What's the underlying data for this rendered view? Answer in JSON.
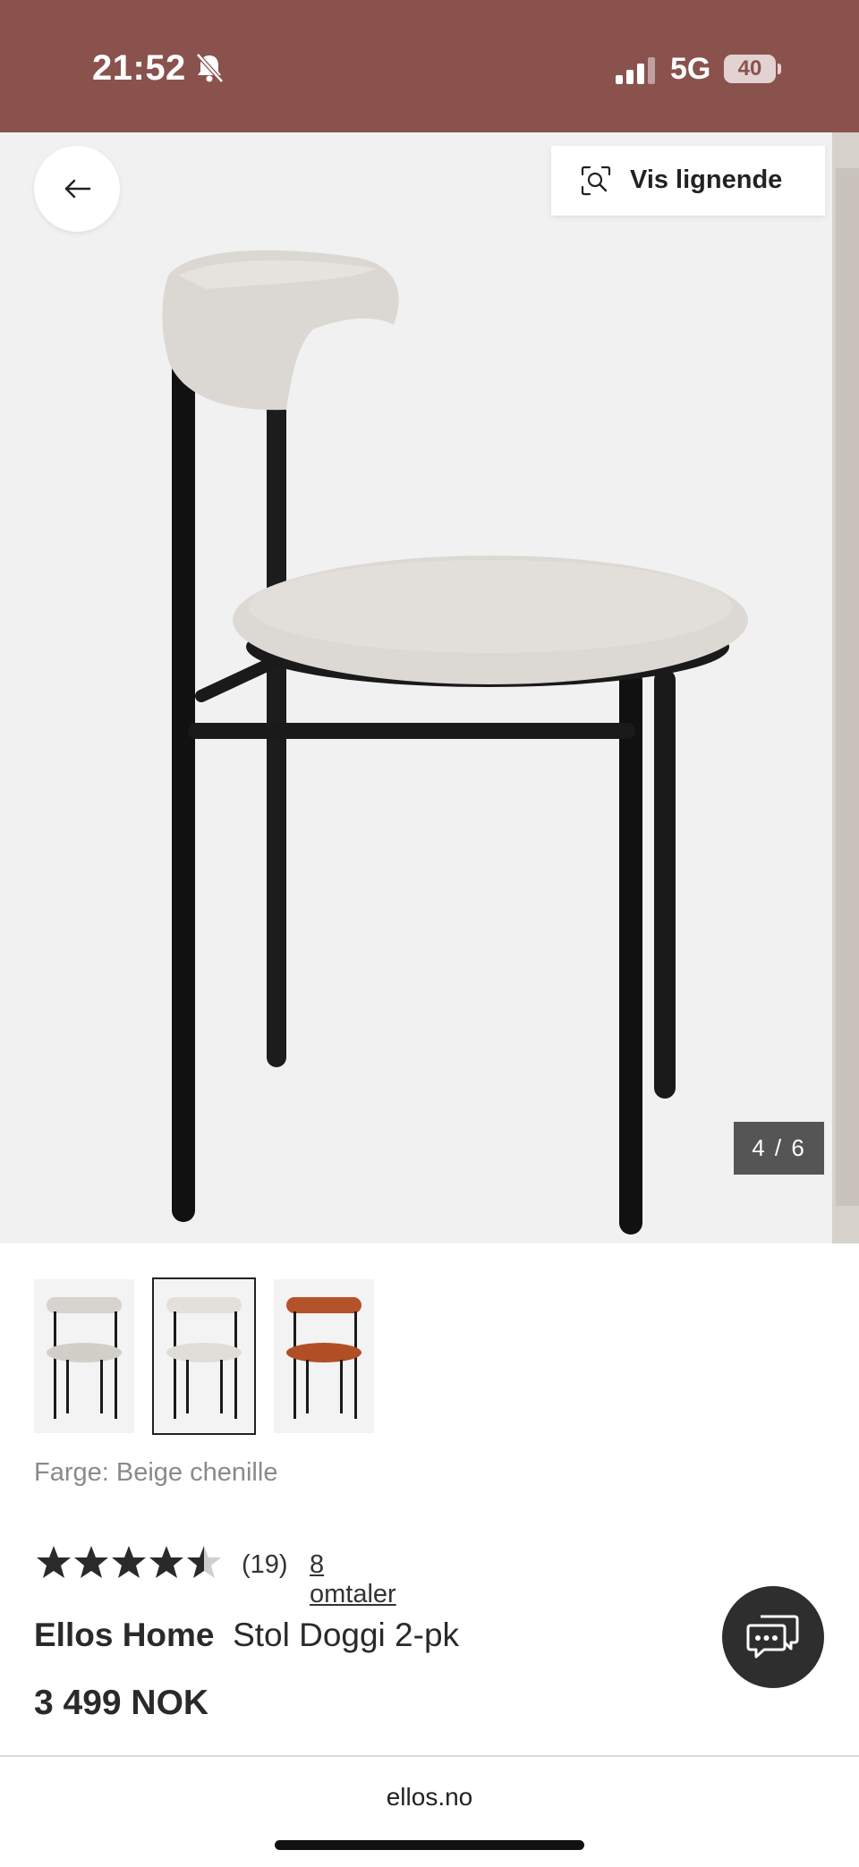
{
  "status_bar": {
    "time": "21:52",
    "network": "5G",
    "battery": "40",
    "icons": [
      "bell-muted-icon",
      "signal-icon",
      "battery-icon"
    ]
  },
  "gallery": {
    "similar_label": "Vis lignende",
    "counter": "4 / 6",
    "icons": [
      "back-arrow-icon",
      "visual-search-icon"
    ]
  },
  "variants": [
    {
      "name": "beige",
      "selected": false,
      "color": "#d7d3cd"
    },
    {
      "name": "white",
      "selected": true,
      "color": "#e6e4e1"
    },
    {
      "name": "rust",
      "selected": false,
      "color": "#b4522a"
    }
  ],
  "product": {
    "color_label": "Farge: Beige chenille",
    "rating": 4.5,
    "rating_count": "(19)",
    "reviews_link": "8 omtaler",
    "brand": "Ellos Home",
    "name": "Stol Doggi 2-pk",
    "price": "3 499 NOK"
  },
  "browser": {
    "url": "ellos.no"
  },
  "colors": {
    "status_bar": "#8a524d",
    "text": "#2a2a2a",
    "chat_button": "#2e2e2e"
  }
}
